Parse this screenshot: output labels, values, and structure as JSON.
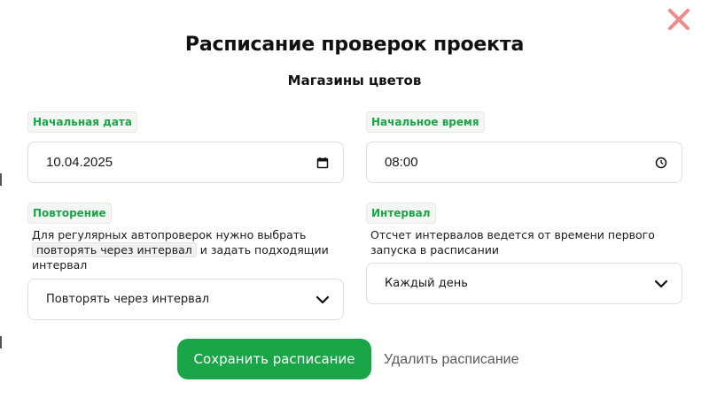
{
  "modal": {
    "title": "Расписание проверок проекта",
    "subtitle": "Магазины цветов"
  },
  "fields": {
    "start_date": {
      "label": "Начальная дата",
      "value": "10.04.2025",
      "icon": "calendar-icon"
    },
    "start_time": {
      "label": "Начальное время",
      "value": "08:00",
      "icon": "clock-icon"
    },
    "repeat": {
      "label": "Повторение",
      "help_part1": "Для регулярных автопроверок нужно выбрать",
      "help_chip": "повторять через интервал",
      "help_part2": "и задать подходящии интервал",
      "selected": "Повторять через интервал",
      "icon": "chevron-down-icon"
    },
    "interval": {
      "label": "Интервал",
      "help": "Отсчет интервалов ведется от времени первого запуска в расписании",
      "selected": "Каждый день",
      "icon": "chevron-down-icon"
    }
  },
  "actions": {
    "save_label": "Сохранить расписание",
    "delete_label": "Удалить расписание"
  },
  "colors": {
    "accent": "#1aa648",
    "close": "#f08a8a",
    "label_bg": "#f4f6f4"
  }
}
